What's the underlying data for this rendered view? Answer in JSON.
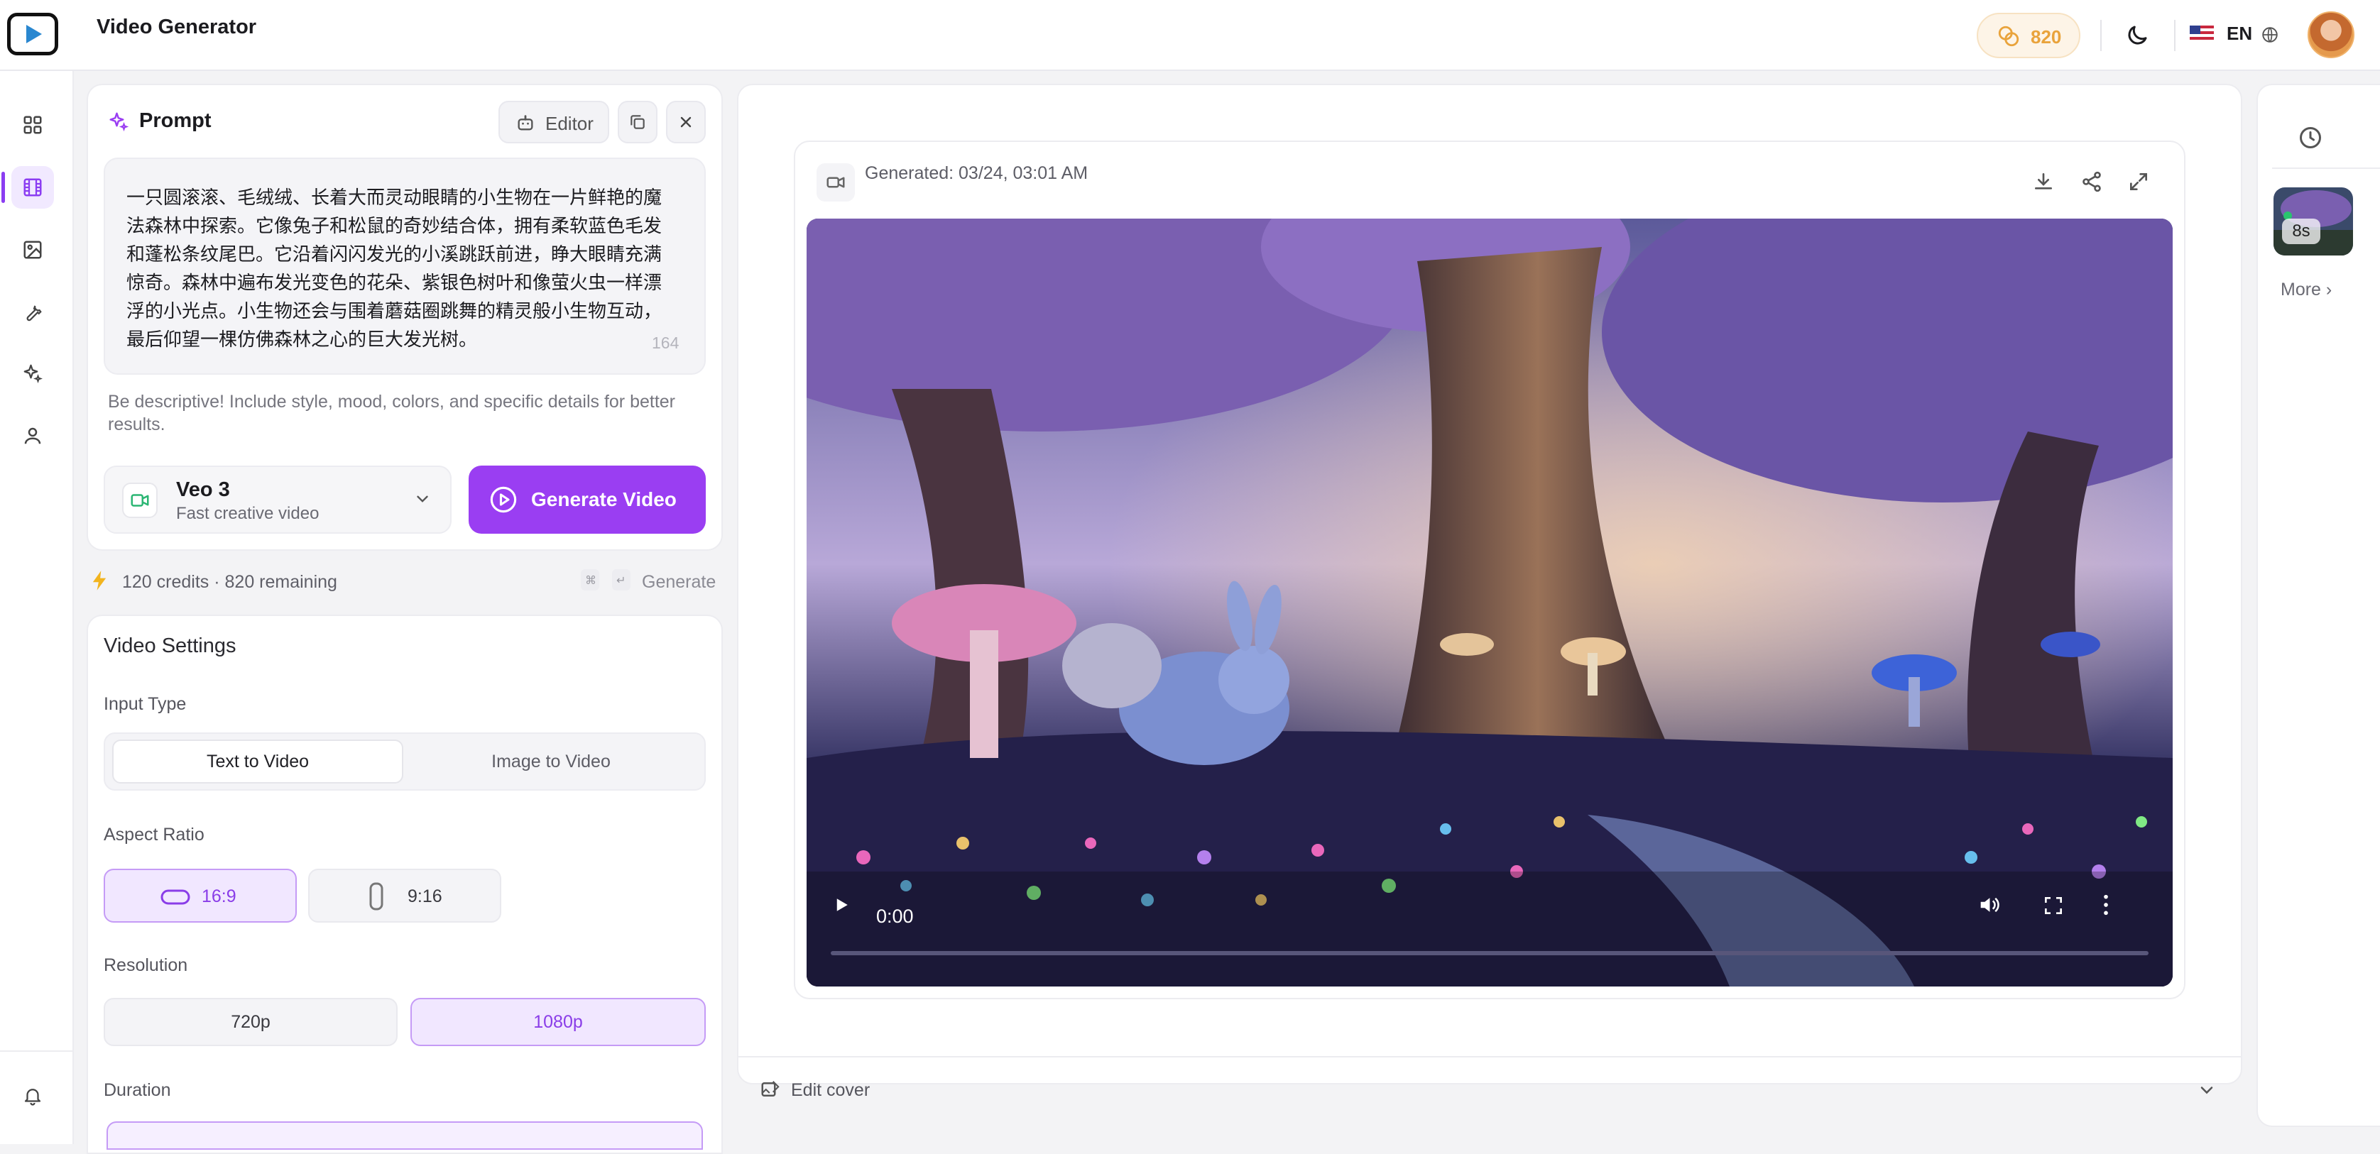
{
  "app": {
    "title": "Video Generator"
  },
  "header": {
    "credits": "820",
    "language": "EN"
  },
  "prompt": {
    "title": "Prompt",
    "editor_label": "Editor",
    "text": "一只圆滚滚、毛绒绒、长着大而灵动眼睛的小生物在一片鲜艳的魔法森林中探索。它像兔子和松鼠的奇妙结合体，拥有柔软蓝色毛发和蓬松条纹尾巴。它沿着闪闪发光的小溪跳跃前进，睁大眼睛充满惊奇。森林中遍布发光变色的花朵、紫银色树叶和像萤火虫一样漂浮的小光点。小生物还会与围着蘑菇圈跳舞的精灵般小生物互动，最后仰望一棵仿佛森林之心的巨大发光树。",
    "char_count": "164",
    "hint": "Be descriptive! Include style, mood, colors, and specific details for better results."
  },
  "model": {
    "name": "Veo 3",
    "subtitle": "Fast creative video"
  },
  "generate": {
    "button_label": "Generate Video",
    "credits_line": "120 credits · 820 remaining",
    "shortcut_label": "Generate"
  },
  "settings": {
    "title": "Video Settings",
    "input_type": {
      "label": "Input Type",
      "options": [
        "Text to Video",
        "Image to Video"
      ],
      "selected": "Text to Video"
    },
    "aspect_ratio": {
      "label": "Aspect Ratio",
      "options": [
        "16:9",
        "9:16"
      ],
      "selected": "16:9"
    },
    "resolution": {
      "label": "Resolution",
      "options": [
        "720p",
        "1080p"
      ],
      "selected": "1080p"
    },
    "duration": {
      "label": "Duration"
    }
  },
  "player": {
    "generated_label": "Generated: 03/24, 03:01 AM",
    "time": "0:00",
    "progress": 0
  },
  "footer": {
    "edit_cover": "Edit cover"
  },
  "history": {
    "badge": "8s",
    "more": "More ›"
  },
  "icons": {
    "logo": "play-icon",
    "sidebar": [
      "grid-icon",
      "film-icon",
      "image-icon",
      "wrench-icon",
      "sparkles-icon",
      "user-icon",
      "bell-icon"
    ],
    "header": [
      "coins-icon",
      "moon-icon",
      "us-flag-icon",
      "globe-icon"
    ]
  },
  "colors": {
    "accent": "#9a3ef2",
    "accent_soft": "#f1e7ff",
    "credit": "#e9a33b"
  }
}
